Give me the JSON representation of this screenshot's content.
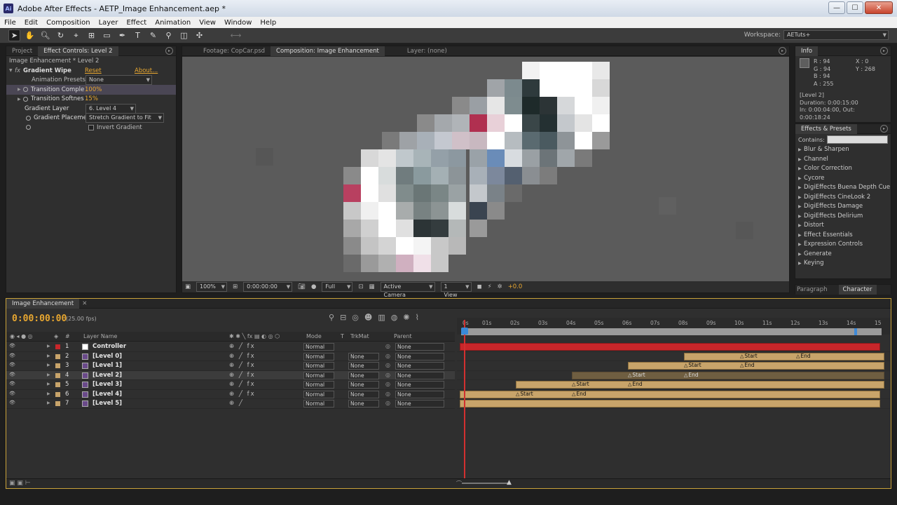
{
  "window": {
    "title": "Adobe After Effects - AETP_Image Enhancement.aep *",
    "app_icon": "Ai",
    "minimize": "—",
    "maximize": "☐",
    "close": "✕"
  },
  "menu": [
    "File",
    "Edit",
    "Composition",
    "Layer",
    "Effect",
    "Animation",
    "View",
    "Window",
    "Help"
  ],
  "toolbar": {
    "workspace_label": "Workspace:",
    "workspace_value": "AETuts+"
  },
  "left_panel": {
    "tabs": [
      "Project",
      "Effect Controls: Level 2"
    ],
    "layer_title": "Image Enhancement * Level 2",
    "effect_name": "Gradient Wipe",
    "reset": "Reset",
    "about": "About...",
    "animation_presets_label": "Animation Presets:",
    "animation_presets_value": "None",
    "transition_completion_label": "Transition Comple",
    "transition_completion_value": "100%",
    "transition_softness_label": "Transition Softnes",
    "transition_softness_value": "15%",
    "gradient_layer_label": "Gradient Layer",
    "gradient_layer_value": "6. Level 4",
    "gradient_placement_label": "Gradient Placeme",
    "gradient_placement_value": "Stretch Gradient to Fit",
    "invert_gradient_label": "Invert Gradient"
  },
  "comp_panel": {
    "tabs": [
      "Footage: CopCar.psd",
      "Composition: Image Enhancement",
      "Layer: (none)"
    ],
    "zoom": "100%",
    "timecode": "0:00:00:00",
    "resolution": "Full",
    "camera": "Active Camera",
    "view": "1 View",
    "exposure": "+0.0"
  },
  "info_panel": {
    "tab": "Info",
    "r": "R : 94",
    "g": "G : 94",
    "b": "B : 94",
    "a": "A : 255",
    "x": "X : 0",
    "y": "Y : 268",
    "layer": "[Level 2]",
    "duration": "Duration: 0:00:15:00",
    "in_out": "In: 0:00:04:00, Out: 0:00:18:24"
  },
  "presets_panel": {
    "tab": "Effects & Presets",
    "contains_label": "Contains:",
    "items": [
      "Blur & Sharpen",
      "Channel",
      "Color Correction",
      "Cycore",
      "DigiEffects Buena Depth Cue",
      "DigiEffects CineLook 2",
      "DigiEffects Damage",
      "DigiEffects Delirium",
      "Distort",
      "Effect Essentials",
      "Expression Controls",
      "Generate",
      "Keying"
    ]
  },
  "char_panel": {
    "tabs": [
      "Paragraph",
      "Character"
    ]
  },
  "timeline": {
    "tab": "Image Enhancement",
    "timecode": "0:00:00:00",
    "fps": "(25.00 fps)",
    "col_hash": "#",
    "col_layer_name": "Layer Name",
    "col_mode": "Mode",
    "col_t": "T",
    "col_trkmat": "TrkMat",
    "col_parent": "Parent",
    "ticks": [
      "0s",
      "01s",
      "02s",
      "03s",
      "04s",
      "05s",
      "06s",
      "07s",
      "08s",
      "09s",
      "10s",
      "11s",
      "12s",
      "13s",
      "14s",
      "15"
    ],
    "layers": [
      {
        "num": "1",
        "name": "Controller",
        "mode": "Normal",
        "trkmat": "",
        "parent": "None",
        "color": "#c8262a",
        "icon": "solid-icon"
      },
      {
        "num": "2",
        "name": "[Level 0]",
        "mode": "Normal",
        "trkmat": "None",
        "parent": "None",
        "color": "#c8a46a",
        "icon": "comp-icon"
      },
      {
        "num": "3",
        "name": "[Level 1]",
        "mode": "Normal",
        "trkmat": "None",
        "parent": "None",
        "color": "#c8a46a",
        "icon": "comp-icon"
      },
      {
        "num": "4",
        "name": "[Level 2]",
        "mode": "Normal",
        "trkmat": "None",
        "parent": "None",
        "color": "#c8a46a",
        "icon": "comp-icon"
      },
      {
        "num": "5",
        "name": "[Level 3]",
        "mode": "Normal",
        "trkmat": "None",
        "parent": "None",
        "color": "#c8a46a",
        "icon": "comp-icon"
      },
      {
        "num": "6",
        "name": "[Level 4]",
        "mode": "Normal",
        "trkmat": "None",
        "parent": "None",
        "color": "#c8a46a",
        "icon": "comp-icon"
      },
      {
        "num": "7",
        "name": "[Level 5]",
        "mode": "Normal",
        "trkmat": "None",
        "parent": "None",
        "color": "#c8a46a",
        "icon": "comp-icon"
      }
    ],
    "marker_start": "Start",
    "marker_end": "End"
  }
}
